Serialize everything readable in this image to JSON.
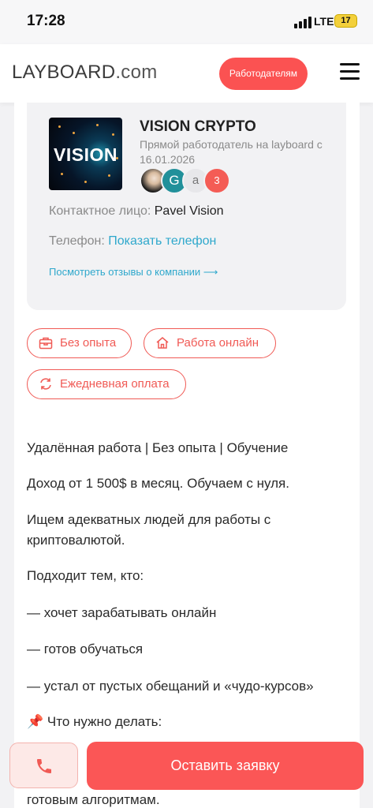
{
  "status_bar": {
    "time": "17:28",
    "network": "LTE",
    "battery": "17"
  },
  "header": {
    "logo_main": "LAYBOARD",
    "logo_domain": ".com",
    "employers_button": "Работодателям",
    "menu_icon": "hamburger-icon"
  },
  "company": {
    "logo_text": "VISION",
    "name": "VISION CRYPTO",
    "subtitle": "Прямой работодатель на layboard с 16.01.2026",
    "avatars": [
      {
        "letter": ""
      },
      {
        "letter": "G"
      },
      {
        "letter": "a"
      },
      {
        "letter": "3"
      }
    ],
    "contact_label": "Контактное лицо:",
    "contact_name": "Pavel Vision",
    "phone_label": "Телефон:",
    "phone_link": "Показать телефон",
    "reviews_link": "Посмотреть отзывы о компании ⟶"
  },
  "tags": [
    {
      "label": "Без опыта",
      "icon": "briefcase-icon"
    },
    {
      "label": "Работа онлайн",
      "icon": "home-icon"
    },
    {
      "label": "Ежедневная оплата",
      "icon": "refresh-icon"
    }
  ],
  "description": [
    "Удалённая работа | Без опыта | Обучение",
    "Доход от 1 500$ в месяц. Обучаем с нуля.",
    "Ищем адекватных людей для работы с криптовалютой.",
    "Подходит тем, кто:",
    "— хочет зарабатывать онлайн",
    "— готов обучаться",
    "— устал от пустых обещаний и «чудо-курсов»",
    "📌 Что нужно делать:",
    "готовым алгоритмам."
  ],
  "bottom_bar": {
    "call_icon": "phone-icon",
    "apply_button": "Оставить заявку"
  },
  "colors": {
    "accent": "#fb5252",
    "link": "#2fa8cc",
    "card_bg": "#f2f2f4"
  }
}
